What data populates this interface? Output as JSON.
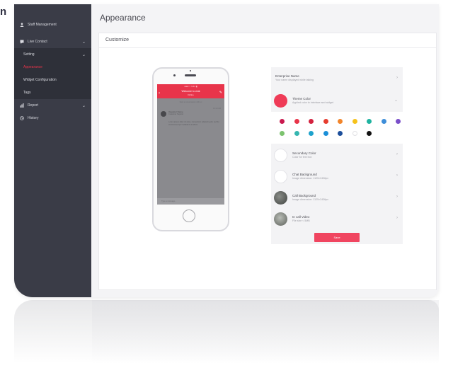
{
  "brand_fragment": "n",
  "sidebar": {
    "items": [
      {
        "label": "Staff Management",
        "icon": "person-icon",
        "chevron": ""
      },
      {
        "label": "Live Contact",
        "icon": "chat-icon",
        "chevron": "⌄"
      },
      {
        "label": "Setting",
        "icon": "",
        "chevron": "⌄"
      },
      {
        "label": "Appearance",
        "icon": "",
        "chevron": ""
      },
      {
        "label": "Widget Configuration",
        "icon": "",
        "chevron": ""
      },
      {
        "label": "Tags",
        "icon": "",
        "chevron": ""
      },
      {
        "label": "Report",
        "icon": "chart-icon",
        "chevron": "⌄"
      },
      {
        "label": "History",
        "icon": "history-icon",
        "chevron": ""
      }
    ]
  },
  "page": {
    "title": "Appearance",
    "card_title": "Customize"
  },
  "phone": {
    "status": "●●●○○  9:41  ▮",
    "header_title": "Welcome to chat",
    "header_sub": "Online",
    "back": "‹",
    "edit": "✎",
    "announcement": "Start a conversation with us",
    "time": "10:24 AM",
    "agent_name": "Operator Name",
    "agent_sub": "Customer Support",
    "message": "Lorem ipsum dolor sit amet, consectetur adipiscing elit, sed do eiusmod tempor incididunt ut labore.",
    "input_placeholder": "Type a message..."
  },
  "settings": {
    "enterprise_name": {
      "label": "Enterprise Name",
      "sub": "Your name displayed while talking"
    },
    "theme_color": {
      "label": "Theme Color",
      "sub": "Applied color to interface and widget",
      "value": "#ef3b57"
    },
    "palette": [
      [
        "#c9194e",
        "#e8344a",
        "#d3223f",
        "#e63c2f",
        "#f2852b",
        "#f6c21b",
        "#1fb3a0",
        "#3e8ed9",
        "#7a4fc9"
      ],
      [
        "#7cc36f",
        "#36b6b0",
        "#1ea2cc",
        "#1a8fd8",
        "#1d4f9b",
        "#ffffff",
        "#121212"
      ]
    ],
    "secondary_color": {
      "label": "Secondary Color",
      "sub": "Color for text box"
    },
    "chat_background": {
      "label": "Chat Background",
      "sub": "Image dimension: 1125×2436px"
    },
    "call_background": {
      "label": "Call Background",
      "sub": "Image dimension: 1125×2436px"
    },
    "incall_video": {
      "label": "In call Video",
      "sub": "File size < 5MB"
    },
    "save_label": "Save"
  },
  "colors": {
    "sidebar_bg": "#3a3c47",
    "accent": "#e8344a"
  }
}
